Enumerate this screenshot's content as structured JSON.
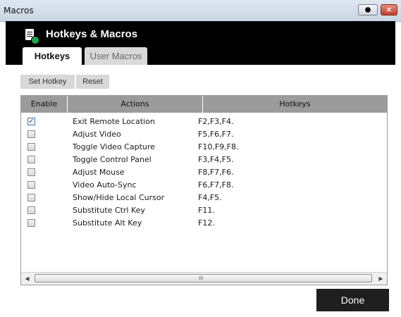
{
  "window": {
    "title": "Macros"
  },
  "header": {
    "title": "Hotkeys & Macros"
  },
  "tabs": [
    {
      "label": "Hotkeys",
      "active": true
    },
    {
      "label": "User Macros",
      "active": false
    }
  ],
  "toolbar": {
    "set_hotkey_label": "Set Hotkey",
    "reset_label": "Reset"
  },
  "table": {
    "columns": [
      "Enable",
      "Actions",
      "Hotkeys"
    ],
    "rows": [
      {
        "enabled": true,
        "action": "Exit Remote Location",
        "hotkey": "F2,F3,F4."
      },
      {
        "enabled": false,
        "action": "Adjust Video",
        "hotkey": "F5,F6,F7."
      },
      {
        "enabled": false,
        "action": "Toggle Video Capture",
        "hotkey": "F10,F9,F8."
      },
      {
        "enabled": false,
        "action": "Toggle Control Panel",
        "hotkey": "F3,F4,F5."
      },
      {
        "enabled": false,
        "action": "Adjust Mouse",
        "hotkey": "F8,F7,F6."
      },
      {
        "enabled": false,
        "action": "Video Auto-Sync",
        "hotkey": "F6,F7,F8."
      },
      {
        "enabled": false,
        "action": "Show/Hide Local Cursor",
        "hotkey": "F4,F5."
      },
      {
        "enabled": false,
        "action": "Substitute Ctrl Key",
        "hotkey": "F11."
      },
      {
        "enabled": false,
        "action": "Substitute Alt Key",
        "hotkey": "F12."
      }
    ]
  },
  "scrollbar": {
    "grip": "III"
  },
  "footer": {
    "done_label": "Done"
  },
  "icons": {
    "toggle": "toggle-switch-icon",
    "close": "close-icon",
    "header": "keyboard-macro-icon",
    "scroll_left": "arrow-left-icon",
    "scroll_right": "arrow-right-icon",
    "check": "checkmark-icon"
  },
  "colors": {
    "header_bg": "#000000",
    "done_bg": "#1e1e1e",
    "table_header_bg": "#9b9b9b",
    "badge": "#21a64a"
  }
}
